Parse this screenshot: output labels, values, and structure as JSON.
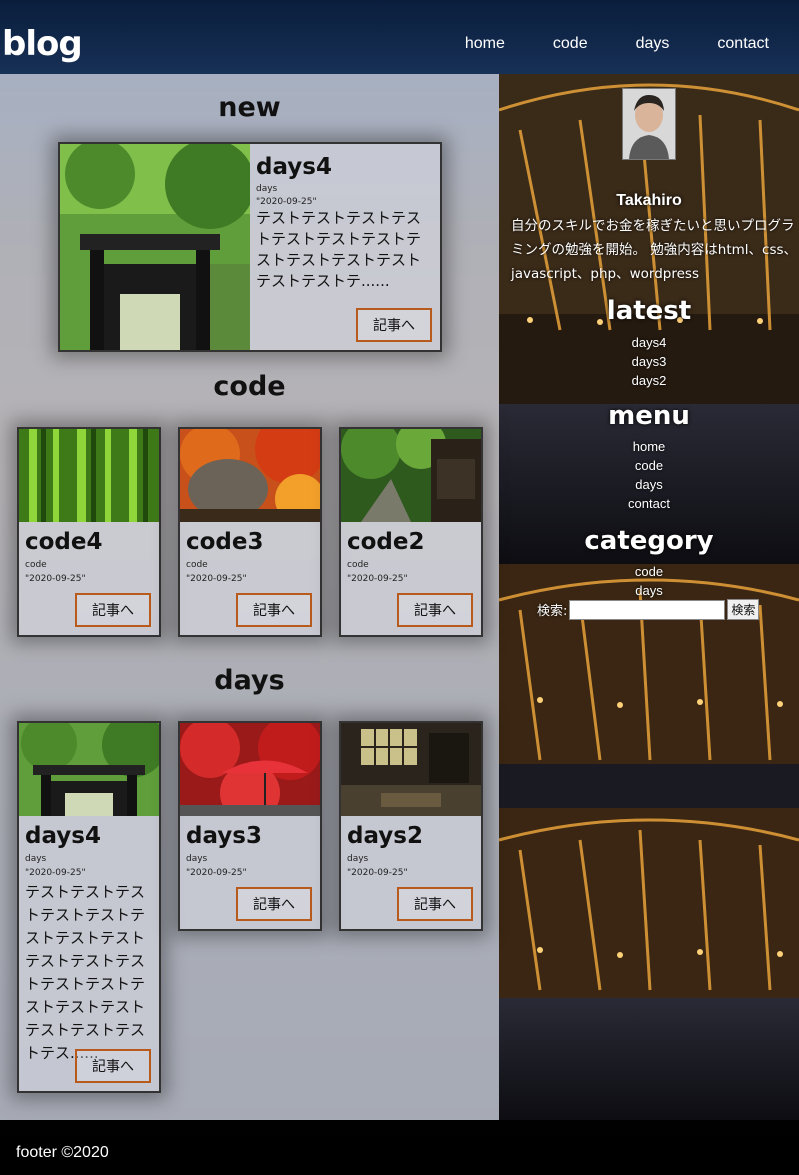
{
  "header": {
    "logo": "blog",
    "nav": [
      "home",
      "code",
      "days",
      "contact"
    ]
  },
  "sections": {
    "new_title": "new",
    "code_title": "code",
    "days_title": "days"
  },
  "new_post": {
    "title": "days4",
    "category": "days",
    "date": "\"2020-09-25\"",
    "excerpt": "テストテストテストテストテストテストテストテストテストテストテストテストテストテ......",
    "button": "記事へ"
  },
  "code_posts": [
    {
      "title": "code4",
      "category": "code",
      "date": "\"2020-09-25\"",
      "button": "記事へ"
    },
    {
      "title": "code3",
      "category": "code",
      "date": "\"2020-09-25\"",
      "button": "記事へ"
    },
    {
      "title": "code2",
      "category": "code",
      "date": "\"2020-09-25\"",
      "button": "記事へ"
    }
  ],
  "days_posts": [
    {
      "title": "days4",
      "category": "days",
      "date": "\"2020-09-25\"",
      "excerpt": "テストテストテストテストテストテストテストテストテストテストテストテストテストテストテストテストテストテストテストテス......",
      "button": "記事へ"
    },
    {
      "title": "days3",
      "category": "days",
      "date": "\"2020-09-25\"",
      "button": "記事へ"
    },
    {
      "title": "days2",
      "category": "days",
      "date": "\"2020-09-25\"",
      "button": "記事へ"
    }
  ],
  "sidebar": {
    "profile_name": "Takahiro",
    "profile_text": "自分のスキルでお金を稼ぎたいと思いプログラミングの勉強を開始。 勉強内容はhtml、css、javascript、php、wordpress",
    "latest_title": "latest",
    "latest": [
      "days4",
      "days3",
      "days2"
    ],
    "menu_title": "menu",
    "menu": [
      "home",
      "code",
      "days",
      "contact"
    ],
    "category_title": "category",
    "categories": [
      "code",
      "days"
    ],
    "search_label": "検索:",
    "search_value": "",
    "search_button": "検索"
  },
  "footer": {
    "text": "footer ©2020"
  },
  "colors": {
    "button_border": "#b85a1c",
    "panel": "#cdd2de"
  }
}
